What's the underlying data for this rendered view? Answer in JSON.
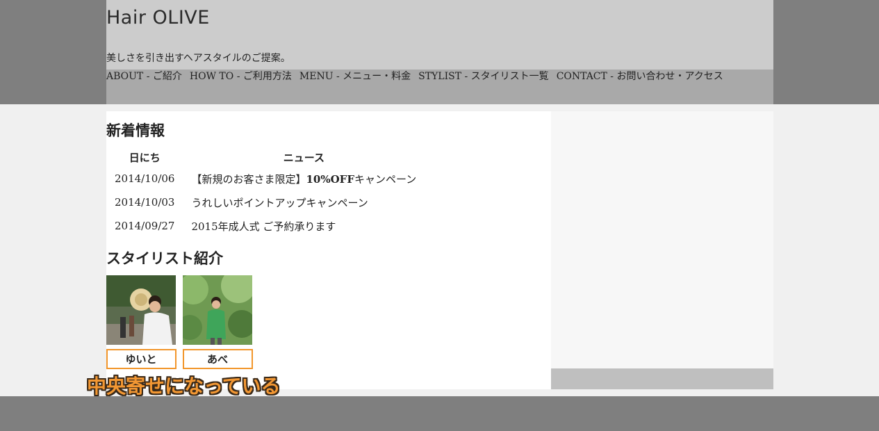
{
  "header": {
    "logo": "Hair OLIVE",
    "tagline": "美しさを引き出すヘアスタイルのご提案。"
  },
  "nav": {
    "items": [
      {
        "label": "ABOUT - ご紹介"
      },
      {
        "label": "HOW TO - ご利用方法"
      },
      {
        "label": "MENU - メニュー・料金"
      },
      {
        "label": "STYLIST - スタイリスト一覧"
      },
      {
        "label": "CONTACT - お問い合わせ・アクセス"
      }
    ]
  },
  "news": {
    "title": "新着情報",
    "headers": {
      "date": "日にち",
      "news": "ニュース"
    },
    "rows": [
      {
        "date": "2014/10/06",
        "text_prefix": "【新規のお客さま限定】",
        "text_bold": "10%OFF",
        "text_suffix": "キャンペーン"
      },
      {
        "date": "2014/10/03",
        "text_prefix": "うれしいポイントアップキャンペーン",
        "text_bold": "",
        "text_suffix": ""
      },
      {
        "date": "2014/09/27",
        "text_prefix": "2015年成人式 ご予約承ります",
        "text_bold": "",
        "text_suffix": ""
      }
    ]
  },
  "stylists": {
    "title": "スタイリスト紹介",
    "items": [
      {
        "name": "ゆいと"
      },
      {
        "name": "あべ"
      }
    ]
  },
  "annotation": {
    "caption": "中央寄せになっている",
    "color": "#f29733"
  }
}
